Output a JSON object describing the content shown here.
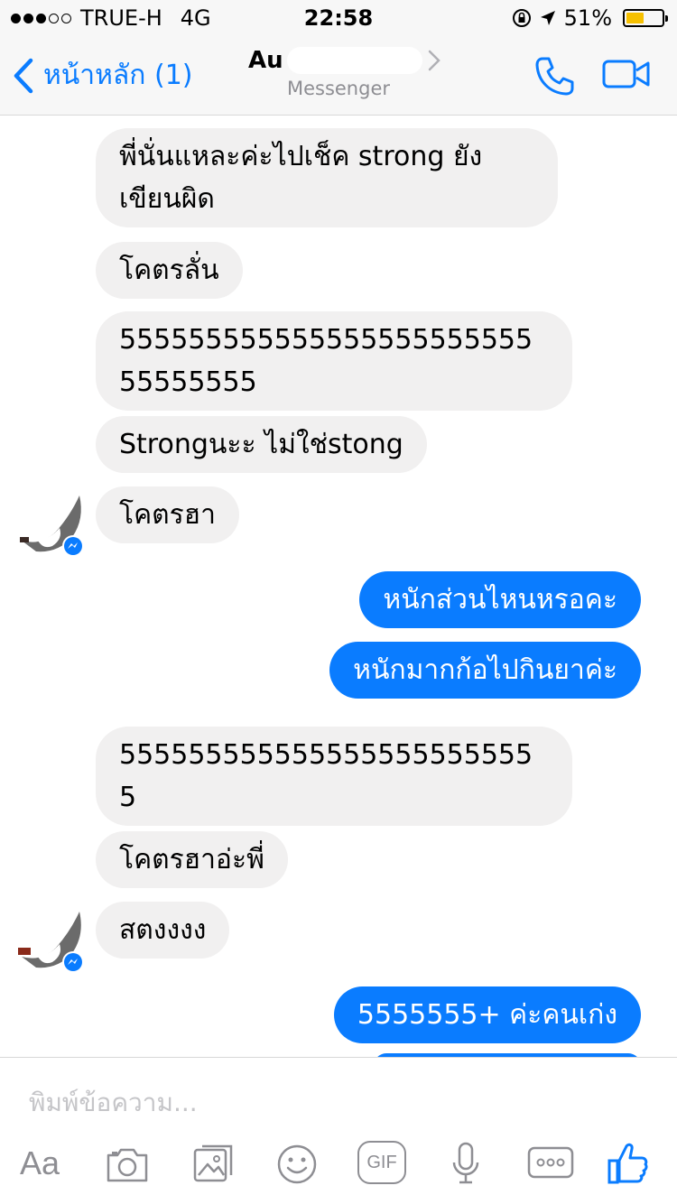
{
  "status_bar": {
    "carrier": "TRUE-H",
    "network": "4G",
    "time": "22:58",
    "battery_percent": "51%",
    "battery_level": 0.51
  },
  "nav": {
    "back_label": "หน้าหลัก (1)",
    "contact_name": "Au",
    "subtitle": "Messenger"
  },
  "messages": [
    {
      "side": "in",
      "text": "พี่นั่นแหละค่ะไปเช็ค strong ยังเขียนผิด"
    },
    {
      "side": "in",
      "text": "โคตรลั่น"
    },
    {
      "side": "in",
      "text": "55555555555555555555555555555555"
    },
    {
      "side": "in",
      "text": "Strongนะะ ไม่ใช่stong"
    },
    {
      "side": "in",
      "text": "โคตรฮา"
    },
    {
      "side": "out",
      "text": "หนักส่วนไหนหรอคะ"
    },
    {
      "side": "out",
      "text": "หนักมากก้อไปกินยาค่ะ"
    },
    {
      "side": "in",
      "text": "5555555555555555555555555"
    },
    {
      "side": "in",
      "text": "โคตรฮาอ่ะพี่"
    },
    {
      "side": "in",
      "text": "สตงงงง"
    },
    {
      "side": "out",
      "text": "5555555+ ค่ะคนเก่ง"
    }
  ],
  "composer": {
    "placeholder": "พิมพ์ข้อความ...",
    "aa_label": "Aa",
    "gif_label": "GIF"
  },
  "colors": {
    "accent": "#0a7cff",
    "incoming_bubble": "#f1f0f0",
    "outgoing_bubble": "#0a7cff",
    "battery": "#f6c000"
  }
}
